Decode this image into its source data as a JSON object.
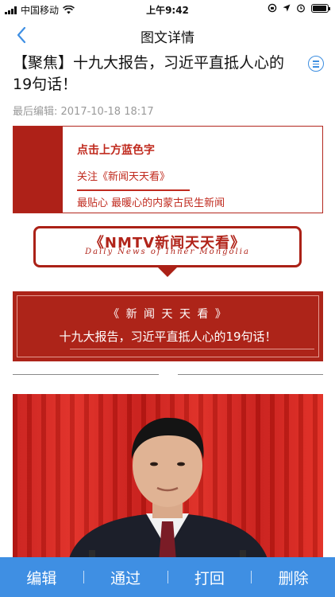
{
  "status_bar": {
    "carrier": "中国移动",
    "time": "上午9:42"
  },
  "nav": {
    "title": "图文详情"
  },
  "article": {
    "headline": "【聚焦】十九大报告，习近平直抵人心的19句话！",
    "edit_meta": "最后编辑: 2017-10-18 18:17"
  },
  "follow_banner": {
    "line1": "点击上方蓝色字",
    "line2": "关注《新闻天天看》",
    "line3": "最贴心 最暖心的内蒙古民生新闻"
  },
  "callout": {
    "brand": "《NMTV新闻天天看》",
    "subtitle": "Daily News of Inner Mongolia"
  },
  "title_card": {
    "tag": "《 新 闻 天 天 看 》",
    "title": "十九大报告，习近平直抵人心的19句话！"
  },
  "toolbar": {
    "edit_label": "编辑",
    "approve_label": "通过",
    "reject_label": "打回",
    "delete_label": "删除"
  },
  "colors": {
    "accent_blue": "#3f8fe3",
    "brand_red": "#ad2419"
  },
  "icons": [
    "signal-icon",
    "wifi-icon",
    "back-chevron-icon",
    "menu-icon",
    "rotation-lock-icon",
    "location-icon",
    "alarm-icon",
    "battery-icon"
  ]
}
